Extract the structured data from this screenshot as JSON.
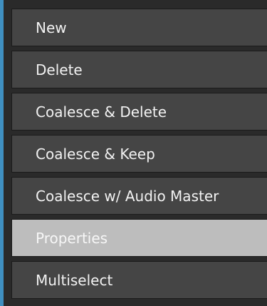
{
  "menu": {
    "items": [
      {
        "label": "New"
      },
      {
        "label": "Delete"
      },
      {
        "label": "Coalesce & Delete"
      },
      {
        "label": "Coalesce & Keep"
      },
      {
        "label": "Coalesce w/ Audio Master"
      },
      {
        "label": "Properties"
      },
      {
        "label": "Multiselect"
      }
    ],
    "highlighted_item": "Properties"
  },
  "colors": {
    "item_background": "#454545",
    "item_highlight_background": "#bdbdbd",
    "item_text": "#f2f2f2",
    "accent_border": "#3f8fc0"
  }
}
